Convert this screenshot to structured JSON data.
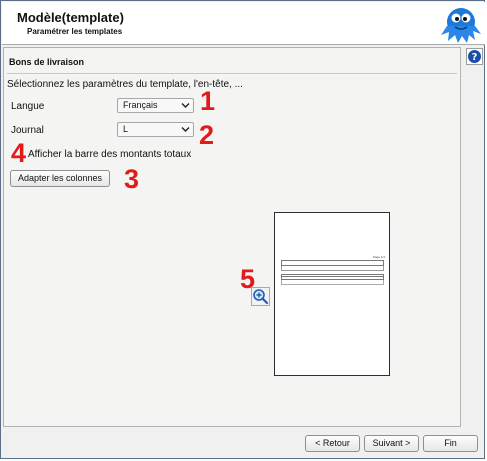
{
  "header": {
    "title": "Modèle(template)",
    "subtitle": "Paramétrer les templates",
    "logo_icon": "blue-mascot-icon"
  },
  "panel": {
    "title": "Bons de livraison",
    "intro": "Sélectionnez les paramètres du template, l'en-tête, ...",
    "langue_label": "Langue",
    "langue_value": "Français",
    "journal_label": "Journal",
    "journal_value": "L",
    "show_totals_label": "Afficher la barre des montants totaux",
    "adapt_columns_label": "Adapter les colonnes",
    "preview_page_label": "Page 1/1"
  },
  "annotations": {
    "n1": "1",
    "n2": "2",
    "n3": "3",
    "n4": "4",
    "n5": "5",
    "color": "#e11a1a"
  },
  "footer": {
    "back_label": "< Retour",
    "next_label": "Suivant >",
    "finish_label": "Fin"
  },
  "icons": {
    "help": "help-icon",
    "zoom": "zoom-in-icon",
    "dropdown": "chevron-down-icon"
  }
}
